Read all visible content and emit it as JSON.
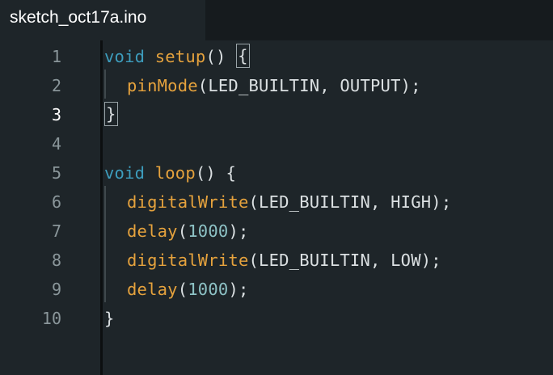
{
  "tab": {
    "filename": "sketch_oct17a.ino"
  },
  "colors": {
    "keyword": "#3d9dbd",
    "function": "#e5a23d",
    "number": "#8ec3c6",
    "text": "#dbe0e2",
    "background": "#1e2529"
  },
  "lines": [
    {
      "n": "1",
      "t": [
        "void",
        " ",
        "setup",
        "() ",
        "{"
      ]
    },
    {
      "n": "2",
      "t": [
        "pinMode",
        "(LED_BUILTIN, OUTPUT);"
      ]
    },
    {
      "n": "3",
      "t": [
        "}"
      ]
    },
    {
      "n": "4",
      "t": []
    },
    {
      "n": "5",
      "t": [
        "void",
        " ",
        "loop",
        "() {"
      ]
    },
    {
      "n": "6",
      "t": [
        "digitalWrite",
        "(LED_BUILTIN, HIGH);"
      ]
    },
    {
      "n": "7",
      "t": [
        "delay",
        "(",
        "1000",
        ");"
      ]
    },
    {
      "n": "8",
      "t": [
        "digitalWrite",
        "(LED_BUILTIN, LOW);"
      ]
    },
    {
      "n": "9",
      "t": [
        "delay",
        "(",
        "1000",
        ");"
      ]
    },
    {
      "n": "10",
      "t": [
        "}"
      ]
    }
  ]
}
